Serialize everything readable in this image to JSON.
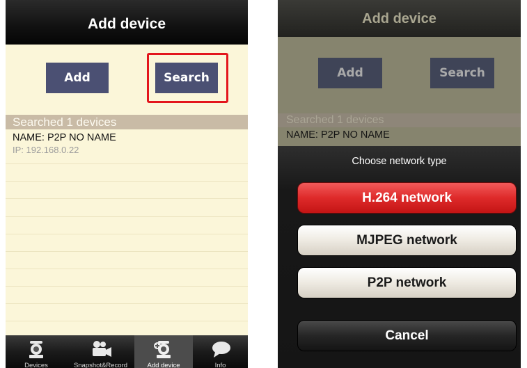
{
  "left": {
    "title": "Add device",
    "add_label": "Add",
    "search_label": "Search",
    "section_header": "Searched 1 devices",
    "devices": [
      {
        "name": "NAME: P2P NO NAME",
        "ip": "IP: 192.168.0.22"
      }
    ],
    "tabs": [
      {
        "label": "Devices",
        "icon": "camera-icon"
      },
      {
        "label": "Snapshot&Record",
        "icon": "video-camera-icon"
      },
      {
        "label": "Add device",
        "icon": "add-camera-icon"
      },
      {
        "label": "Info",
        "icon": "speech-bubble-icon"
      }
    ]
  },
  "right": {
    "title": "Add device",
    "add_label": "Add",
    "search_label": "Search",
    "section_header": "Searched 1 devices",
    "device_name": "NAME: P2P NO NAME",
    "sheet": {
      "title": "Choose network type",
      "options": [
        "H.264 network",
        "MJPEG network",
        "P2P network"
      ],
      "cancel": "Cancel"
    }
  },
  "colors": {
    "highlight": "#e3161c",
    "button": "#4b5073",
    "list_background": "#fbf6d9",
    "section_header": "#c9bba6",
    "selected_option": "#de2a2a"
  }
}
